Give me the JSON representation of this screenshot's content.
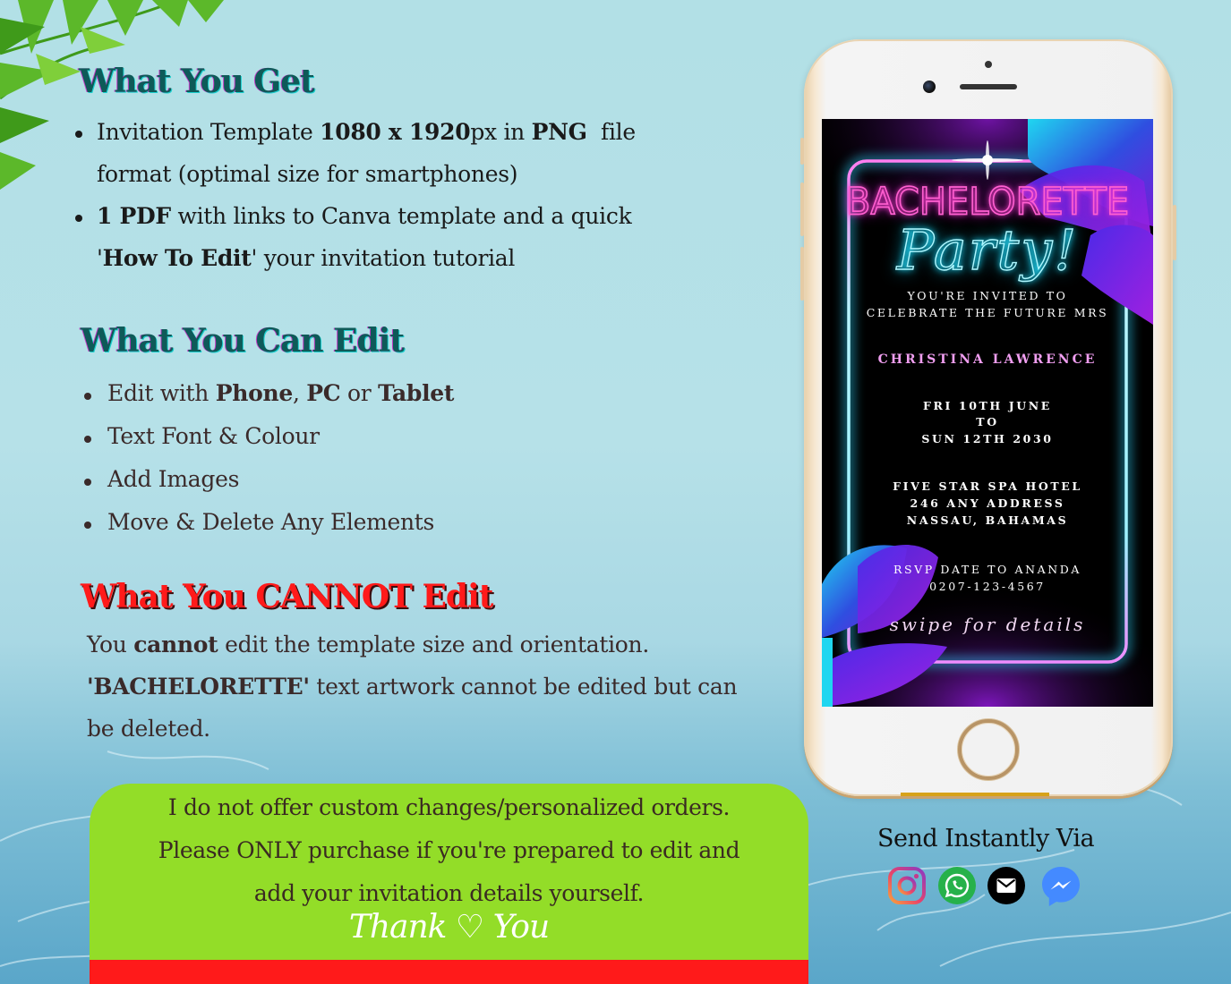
{
  "what_you_get": {
    "heading": "What You Get",
    "items": [
      {
        "line1_parts": [
          {
            "t": "Invitation Template ",
            "b": false
          },
          {
            "t": "1080 x 1920",
            "b": true
          },
          {
            "t": "px in ",
            "b": false
          },
          {
            "t": "PNG",
            "b": true
          },
          {
            "t": "  file",
            "b": false
          }
        ],
        "line2": "format (optimal size for smartphones)"
      },
      {
        "line1_parts": [
          {
            "t": "1 PDF",
            "b": true
          },
          {
            "t": " with links to Canva template and a quick",
            "b": false
          }
        ],
        "line2_parts": [
          {
            "t": "'",
            "b": false
          },
          {
            "t": "How To Edit",
            "b": true
          },
          {
            "t": "' your invitation tutorial",
            "b": false
          }
        ]
      }
    ]
  },
  "what_you_can_edit": {
    "heading": "What You Can Edit",
    "items": [
      {
        "parts": [
          {
            "t": "Edit with ",
            "b": false
          },
          {
            "t": "Phone",
            "b": true
          },
          {
            "t": ", ",
            "b": false
          },
          {
            "t": "PC",
            "b": true
          },
          {
            "t": " or ",
            "b": false
          },
          {
            "t": "Tablet",
            "b": true
          }
        ]
      },
      {
        "parts": [
          {
            "t": "Text Font & Colour",
            "b": false
          }
        ]
      },
      {
        "parts": [
          {
            "t": "Add Images",
            "b": false
          }
        ]
      },
      {
        "parts": [
          {
            "t": "Move & Delete Any Elements",
            "b": false
          }
        ]
      }
    ]
  },
  "what_you_cannot_edit": {
    "heading": "What You CANNOT Edit",
    "lines": [
      [
        {
          "t": "You ",
          "b": false
        },
        {
          "t": "cannot",
          "b": true
        },
        {
          "t": " edit the template size and orientation.",
          "b": false
        }
      ],
      [
        {
          "t": "'BACHELORETTE'",
          "b": true
        },
        {
          "t": " text artwork cannot be edited but can",
          "b": false
        }
      ],
      [
        {
          "t": "be deleted.",
          "b": false
        }
      ]
    ]
  },
  "notice": {
    "lines": [
      "I do not offer custom changes/personalized orders.",
      "Please ONLY purchase if you're prepared to edit and",
      "add your invitation details yourself."
    ],
    "thanks": "Thank ♡ You",
    "colors": {
      "box": "#93dd28",
      "bar": "#ff1a1a"
    }
  },
  "invitation": {
    "title": "BACHELORETTE",
    "subtitle": "Party!",
    "invite_line1": "YOU'RE INVITED TO",
    "invite_line2": "CELEBRATE THE FUTURE MRS",
    "name": "CHRISTINA LAWRENCE",
    "date_line1": "FRI 10TH JUNE",
    "date_line2": "TO",
    "date_line3": "SUN 12TH 2030",
    "venue_line1": "FIVE STAR SPA HOTEL",
    "venue_line2": "246 ANY ADDRESS",
    "venue_line3": "NASSAU, BAHAMAS",
    "rsvp_line1": "RSVP DATE TO ANANDA",
    "rsvp_line2": "0207-123-4567",
    "swipe": "swipe for details",
    "colors": {
      "neon_pink": "#ff5fd0",
      "neon_cyan": "#22e0ff",
      "name": "#f09ef0"
    }
  },
  "share": {
    "label": "Send Instantly Via",
    "icons": [
      {
        "name": "instagram-icon",
        "label": "Instagram"
      },
      {
        "name": "whatsapp-icon",
        "label": "WhatsApp"
      },
      {
        "name": "email-icon",
        "label": "Email"
      },
      {
        "name": "messenger-icon",
        "label": "Messenger"
      }
    ]
  }
}
